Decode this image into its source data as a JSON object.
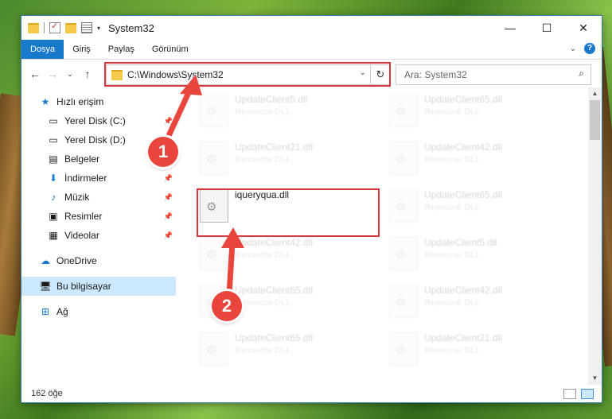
{
  "window": {
    "title": "System32"
  },
  "ribbon": {
    "tabs": [
      "Dosya",
      "Giriş",
      "Paylaş",
      "Görünüm"
    ],
    "help": "?"
  },
  "address": {
    "path": "C:\\Windows\\System32"
  },
  "search": {
    "placeholder": "Ara: System32"
  },
  "nav": {
    "quick_access": "Hızlı erişim",
    "items": [
      "Yerel Disk (C:)",
      "Yerel Disk (D:)",
      "Belgeler",
      "İndirmeler",
      "Müzik",
      "Resimler",
      "Videolar"
    ],
    "onedrive": "OneDrive",
    "this_pc": "Bu bilgisayar",
    "network": "Ağ"
  },
  "files": {
    "type_label": "Resource DLL",
    "col1": [
      "UpdateClient5.dll",
      "UpdateClient21.dll",
      "iqueryqua.dll",
      "UpdateClient42.dll",
      "UpdateClient65.dll",
      "UpdateClient65.dll"
    ],
    "col2": [
      "UpdateClient65.dll",
      "UpdateClient42.dll",
      "UpdateClient65.dll",
      "UpdateClient5.dll",
      "UpdateClient42.dll",
      "UpdateClient21.dll"
    ]
  },
  "status": {
    "count": "162 öğe"
  },
  "annotations": {
    "step1": "1",
    "step2": "2"
  },
  "colors": {
    "accent": "#1979ca",
    "highlight": "#d9363e",
    "badge": "#e8453c"
  }
}
